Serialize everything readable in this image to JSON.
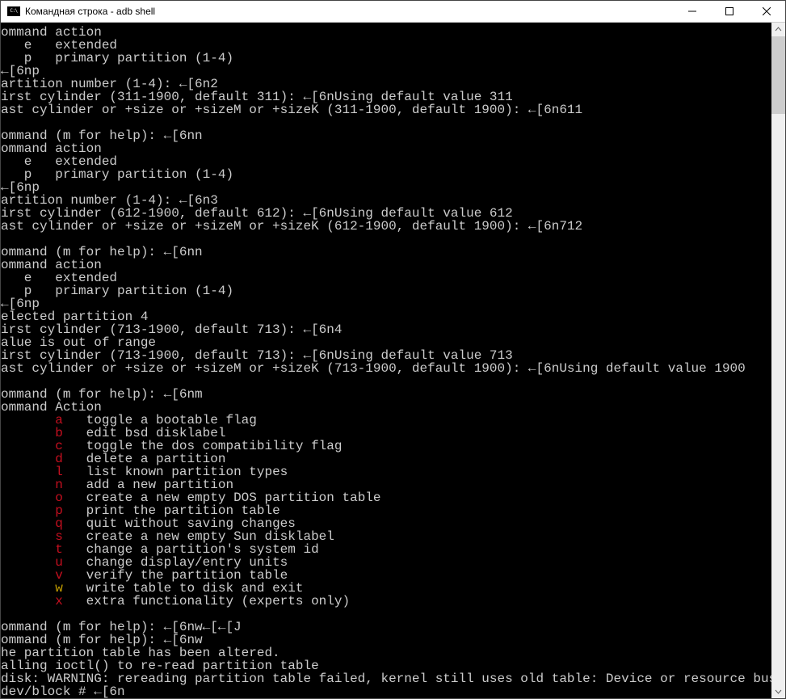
{
  "window": {
    "title": "Командная строка - adb  shell"
  },
  "scrollbar": {
    "thumb_top_pct": 0,
    "thumb_height_pct": 12
  },
  "lines": [
    {
      "t": "ommand action"
    },
    {
      "t": "   e   extended"
    },
    {
      "t": "   p   primary partition (1-4)"
    },
    {
      "t": "←[6np"
    },
    {
      "t": "artition number (1-4): ←[6n2"
    },
    {
      "t": "irst cylinder (311-1900, default 311): ←[6nUsing default value 311"
    },
    {
      "t": "ast cylinder or +size or +sizeM or +sizeK (311-1900, default 1900): ←[6n611"
    },
    {
      "t": ""
    },
    {
      "t": "ommand (m for help): ←[6nn"
    },
    {
      "t": "ommand action"
    },
    {
      "t": "   e   extended"
    },
    {
      "t": "   p   primary partition (1-4)"
    },
    {
      "t": "←[6np"
    },
    {
      "t": "artition number (1-4): ←[6n3"
    },
    {
      "t": "irst cylinder (612-1900, default 612): ←[6nUsing default value 612"
    },
    {
      "t": "ast cylinder or +size or +sizeM or +sizeK (612-1900, default 1900): ←[6n712"
    },
    {
      "t": ""
    },
    {
      "t": "ommand (m for help): ←[6nn"
    },
    {
      "t": "ommand action"
    },
    {
      "t": "   e   extended"
    },
    {
      "t": "   p   primary partition (1-4)"
    },
    {
      "t": "←[6np"
    },
    {
      "t": "elected partition 4"
    },
    {
      "t": "irst cylinder (713-1900, default 713): ←[6n4"
    },
    {
      "t": "alue is out of range"
    },
    {
      "t": "irst cylinder (713-1900, default 713): ←[6nUsing default value 713"
    },
    {
      "t": "ast cylinder or +size or +sizeM or +sizeK (713-1900, default 1900): ←[6nUsing default value 1900"
    },
    {
      "t": ""
    },
    {
      "t": "ommand (m for help): ←[6nm"
    },
    {
      "t": "ommand Action"
    },
    {
      "m": [
        {
          "c": "red",
          "t": "a"
        },
        {
          "c": "",
          "t": "   toggle a bootable flag"
        }
      ],
      "pad": "       "
    },
    {
      "m": [
        {
          "c": "red",
          "t": "b"
        },
        {
          "c": "",
          "t": "   edit bsd disklabel"
        }
      ],
      "pad": "       "
    },
    {
      "m": [
        {
          "c": "red",
          "t": "c"
        },
        {
          "c": "",
          "t": "   toggle the dos compatibility flag"
        }
      ],
      "pad": "       "
    },
    {
      "m": [
        {
          "c": "red",
          "t": "d"
        },
        {
          "c": "",
          "t": "   delete a partition"
        }
      ],
      "pad": "       "
    },
    {
      "m": [
        {
          "c": "red",
          "t": "l"
        },
        {
          "c": "",
          "t": "   list known partition types"
        }
      ],
      "pad": "       "
    },
    {
      "m": [
        {
          "c": "red",
          "t": "n"
        },
        {
          "c": "",
          "t": "   add a new partition"
        }
      ],
      "pad": "       "
    },
    {
      "m": [
        {
          "c": "red",
          "t": "o"
        },
        {
          "c": "",
          "t": "   create a new empty DOS partition table"
        }
      ],
      "pad": "       "
    },
    {
      "m": [
        {
          "c": "red",
          "t": "p"
        },
        {
          "c": "",
          "t": "   print the partition table"
        }
      ],
      "pad": "       "
    },
    {
      "m": [
        {
          "c": "red",
          "t": "q"
        },
        {
          "c": "",
          "t": "   quit without saving changes"
        }
      ],
      "pad": "       "
    },
    {
      "m": [
        {
          "c": "red",
          "t": "s"
        },
        {
          "c": "",
          "t": "   create a new empty Sun disklabel"
        }
      ],
      "pad": "       "
    },
    {
      "m": [
        {
          "c": "red",
          "t": "t"
        },
        {
          "c": "",
          "t": "   change a partition's system id"
        }
      ],
      "pad": "       "
    },
    {
      "m": [
        {
          "c": "red",
          "t": "u"
        },
        {
          "c": "",
          "t": "   change display/entry units"
        }
      ],
      "pad": "       "
    },
    {
      "m": [
        {
          "c": "red",
          "t": "v"
        },
        {
          "c": "",
          "t": "   verify the partition table"
        }
      ],
      "pad": "       "
    },
    {
      "m": [
        {
          "c": "ylw",
          "t": "w"
        },
        {
          "c": "",
          "t": "   write table to disk and exit"
        }
      ],
      "pad": "       "
    },
    {
      "m": [
        {
          "c": "red",
          "t": "x"
        },
        {
          "c": "",
          "t": "   extra functionality (experts only)"
        }
      ],
      "pad": "       "
    },
    {
      "t": ""
    },
    {
      "t": "ommand (m for help): ←[6nw←[←[J"
    },
    {
      "t": "ommand (m for help): ←[6nw"
    },
    {
      "t": "he partition table has been altered."
    },
    {
      "t": "alling ioctl() to re-read partition table"
    },
    {
      "t": "disk: WARNING: rereading partition table failed, kernel still uses old table: Device or resource busy"
    },
    {
      "t": "dev/block # ←[6n"
    }
  ]
}
